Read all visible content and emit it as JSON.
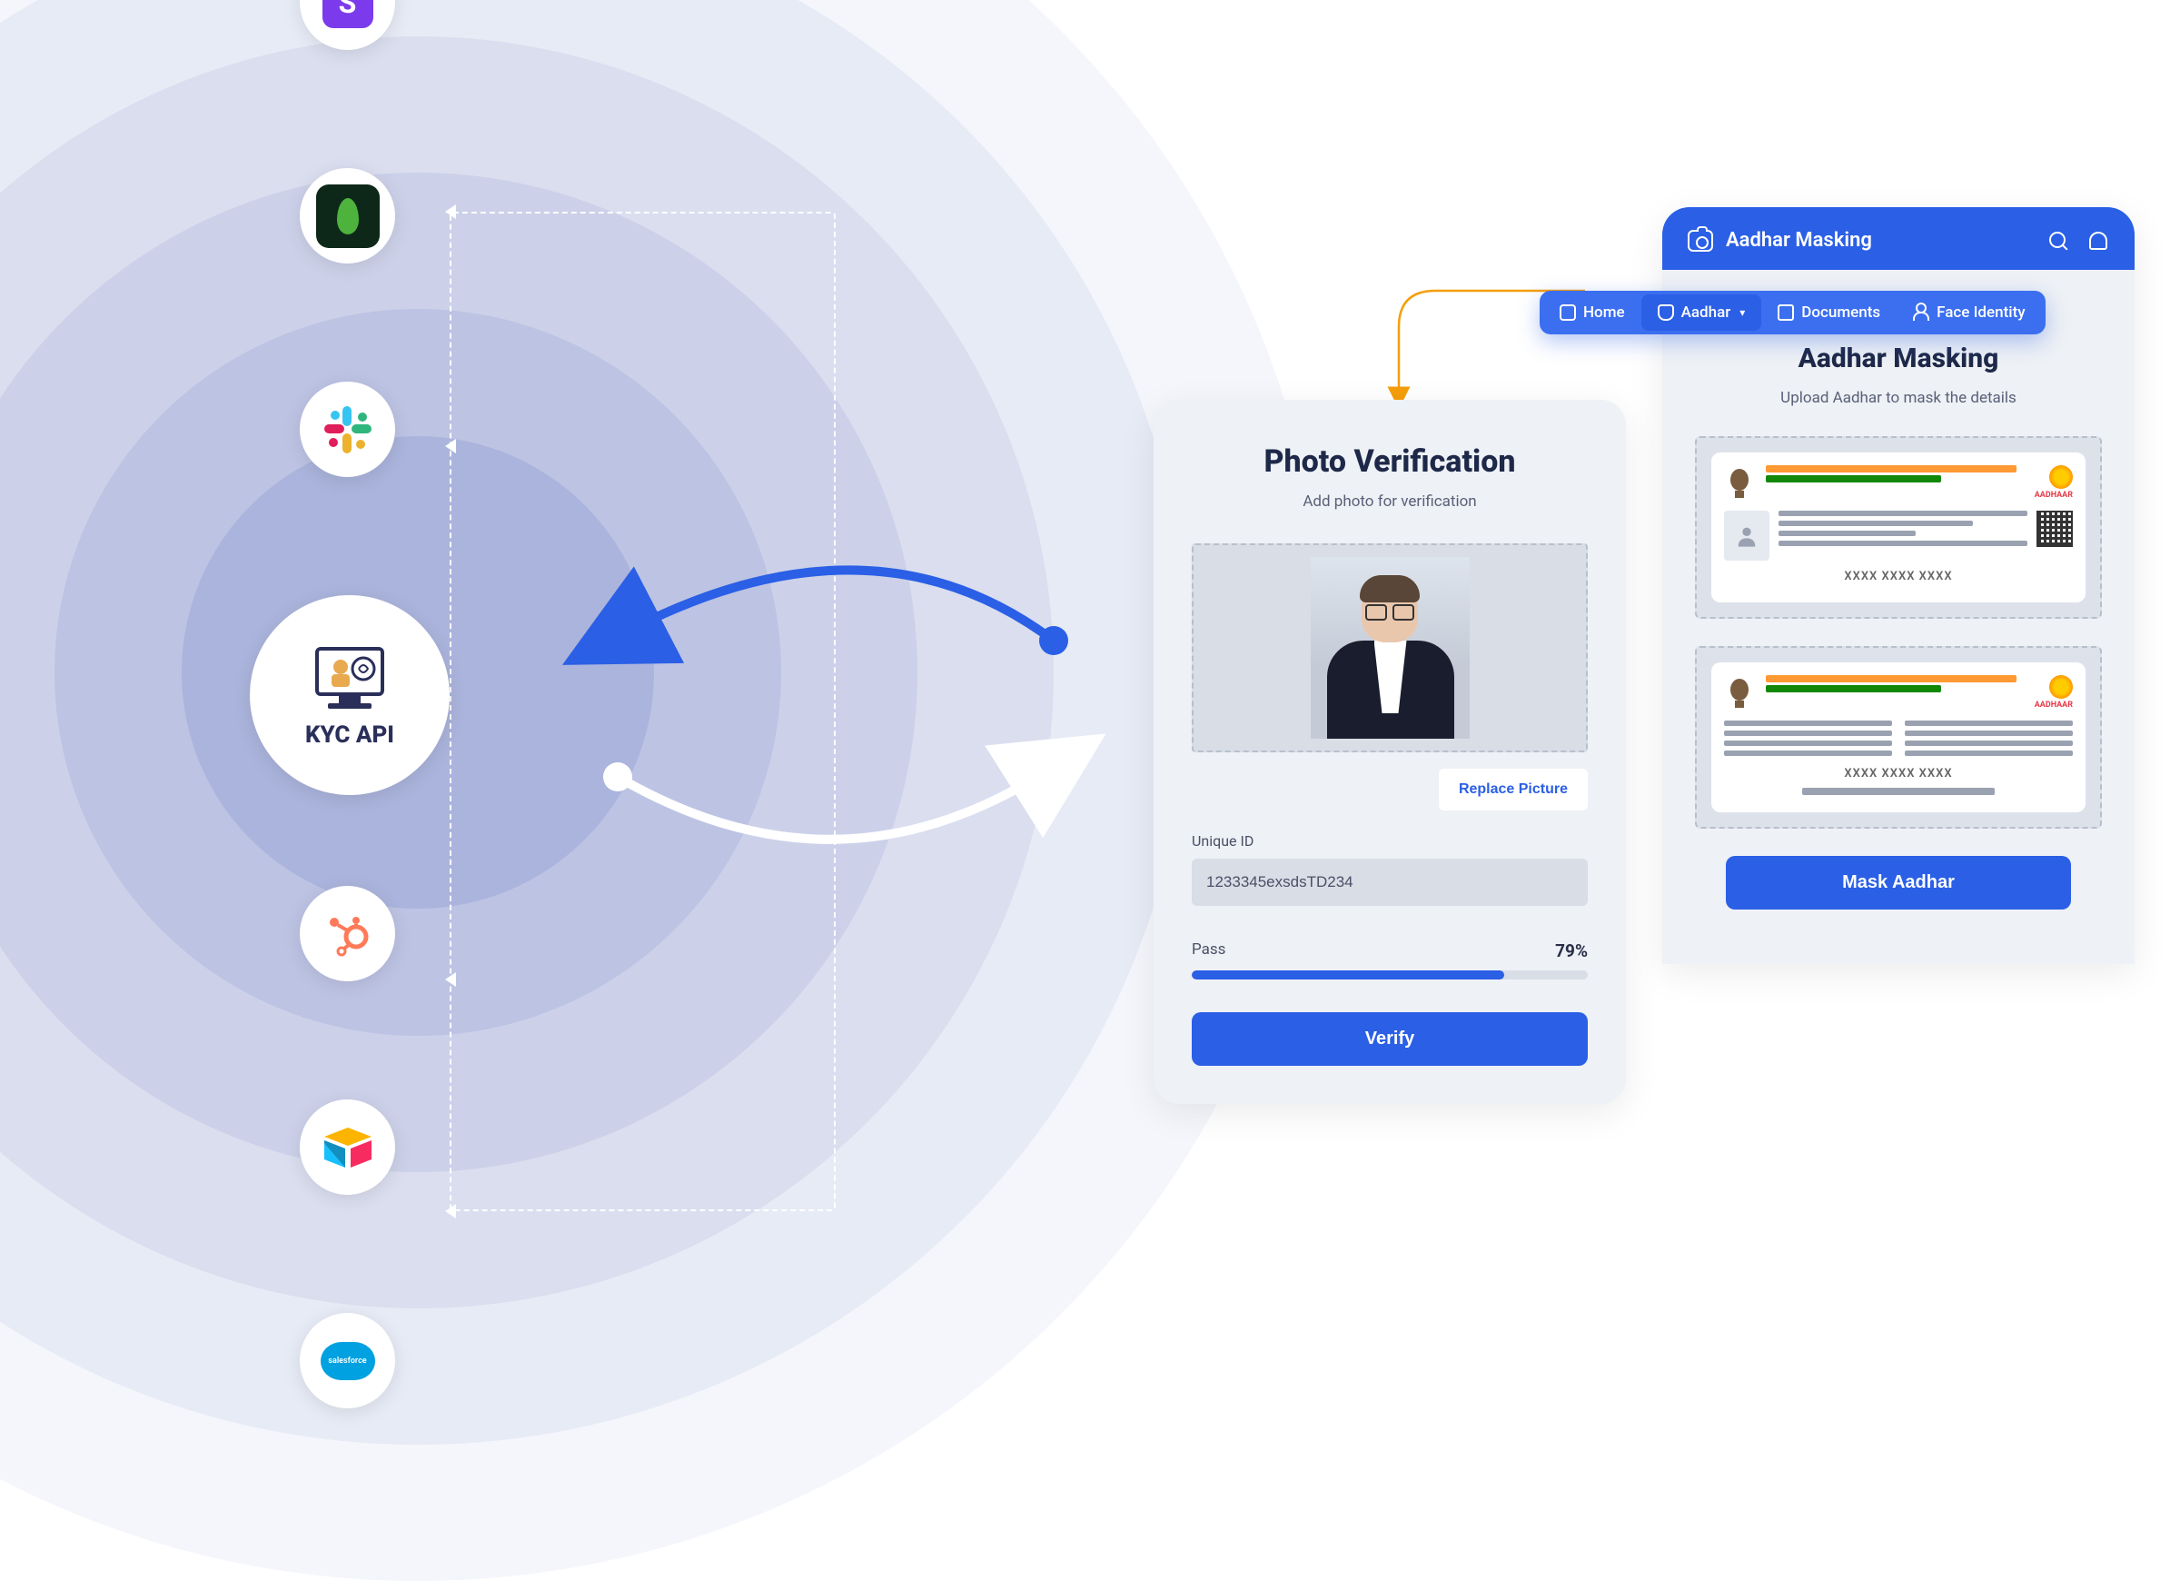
{
  "integrations": {
    "items": [
      "stripe",
      "mongo",
      "slack",
      "kyc-api",
      "hubspot",
      "airtable",
      "salesforce"
    ],
    "center_label": "KYC API"
  },
  "photo_verification": {
    "title": "Photo Verification",
    "subtitle": "Add photo for verification",
    "replace_button": "Replace Picture",
    "unique_id_label": "Unique ID",
    "unique_id_value": "1233345exsdsTD234",
    "pass_label": "Pass",
    "pass_percent": "79%",
    "pass_percent_num": 79,
    "verify_button": "Verify"
  },
  "aadhar": {
    "header_title": "Aadhar Masking",
    "tabs": {
      "home": "Home",
      "aadhar": "Aadhar",
      "documents": "Documents",
      "face_identity": "Face Identity"
    },
    "body_title": "Aadhar Masking",
    "body_subtitle": "Upload Aadhar to mask the details",
    "card_number": "XXXX XXXX XXXX",
    "logo_text": "AADHAAR",
    "mask_button": "Mask Aadhar"
  },
  "colors": {
    "primary": "#2a5fe6",
    "orange": "#ff9933",
    "green": "#138808"
  }
}
